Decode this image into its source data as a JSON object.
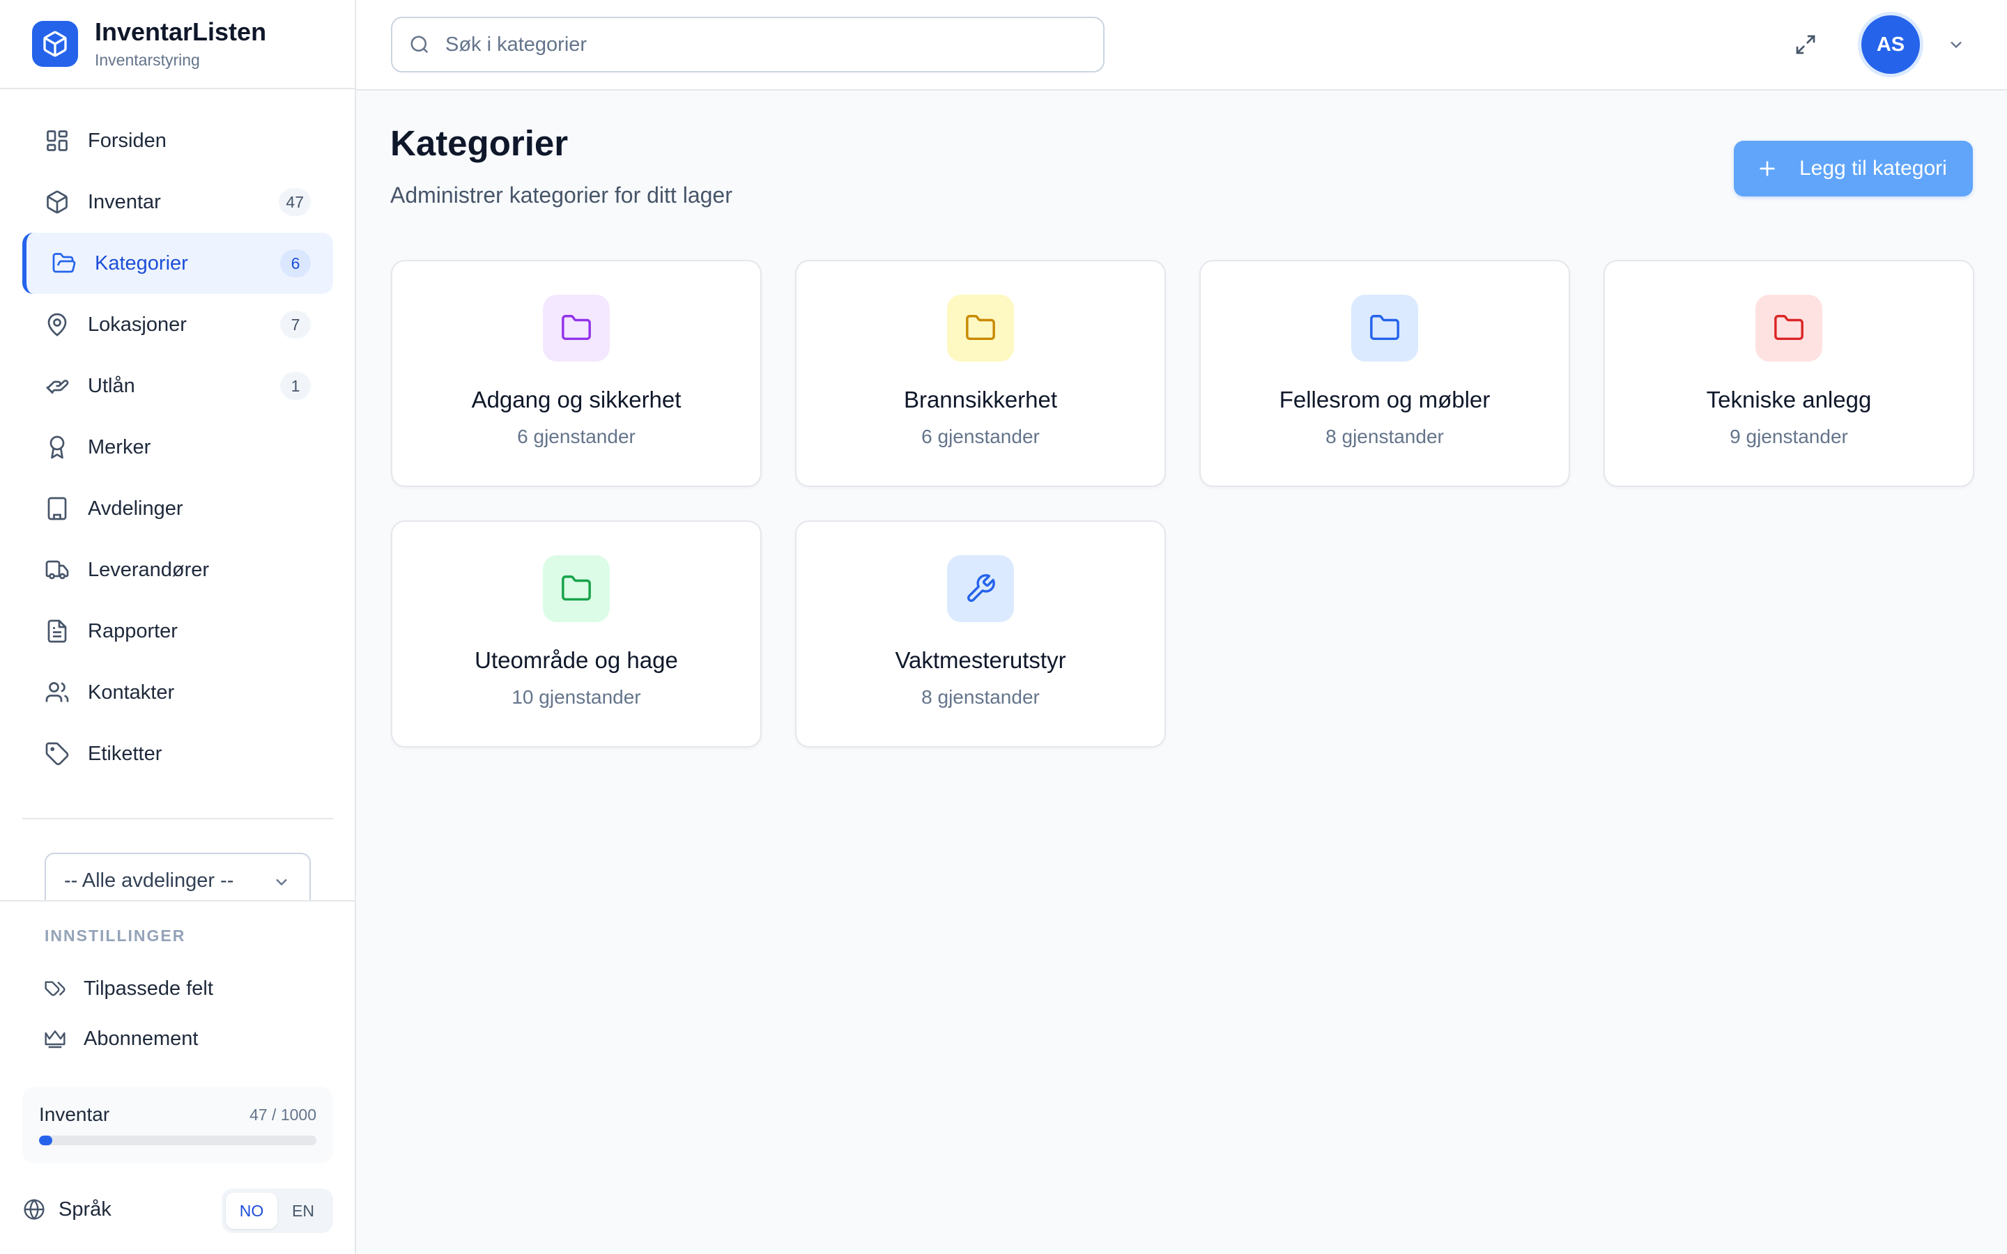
{
  "app": {
    "name": "InventarListen",
    "subtitle": "Inventarstyring"
  },
  "nav": [
    {
      "label": "Forsiden",
      "icon": "dashboard-icon",
      "badge": null
    },
    {
      "label": "Inventar",
      "icon": "box-icon",
      "badge": "47"
    },
    {
      "label": "Kategorier",
      "icon": "folder-open-icon",
      "badge": "6",
      "active": true
    },
    {
      "label": "Lokasjoner",
      "icon": "map-pin-icon",
      "badge": "7"
    },
    {
      "label": "Utlån",
      "icon": "hand-icon",
      "badge": "1"
    },
    {
      "label": "Merker",
      "icon": "award-icon",
      "badge": null
    },
    {
      "label": "Avdelinger",
      "icon": "building-icon",
      "badge": null
    },
    {
      "label": "Leverandører",
      "icon": "truck-icon",
      "badge": null
    },
    {
      "label": "Rapporter",
      "icon": "file-text-icon",
      "badge": null
    },
    {
      "label": "Kontakter",
      "icon": "users-icon",
      "badge": null
    },
    {
      "label": "Etiketter",
      "icon": "tag-icon",
      "badge": null
    }
  ],
  "department_select": {
    "value": "-- Alle avdelinger --"
  },
  "settings": {
    "title": "INNSTILLINGER",
    "items": [
      {
        "label": "Tilpassede felt",
        "icon": "tags-icon"
      },
      {
        "label": "Abonnement",
        "icon": "crown-icon"
      }
    ]
  },
  "usage": {
    "label": "Inventar",
    "count": "47 / 1000",
    "fraction": 0.047
  },
  "language": {
    "label": "Språk",
    "options": [
      "NO",
      "EN"
    ],
    "selected": "NO"
  },
  "search": {
    "placeholder": "Søk i kategorier"
  },
  "user": {
    "initials": "AS"
  },
  "page": {
    "title": "Kategorier",
    "subtitle": "Administrer kategorier for ditt lager",
    "add_label": "Legg til kategori"
  },
  "categories": [
    {
      "name": "Adgang og sikkerhet",
      "count": "6 gjenstander",
      "icon": "folder-icon",
      "color": "#9333ea",
      "bg": "#f3e8ff"
    },
    {
      "name": "Brannsikkerhet",
      "count": "6 gjenstander",
      "icon": "folder-icon",
      "color": "#ca8a04",
      "bg": "#fef9c3"
    },
    {
      "name": "Fellesrom og møbler",
      "count": "8 gjenstander",
      "icon": "folder-icon",
      "color": "#2563eb",
      "bg": "#dbeafe"
    },
    {
      "name": "Tekniske anlegg",
      "count": "9 gjenstander",
      "icon": "folder-icon",
      "color": "#dc2626",
      "bg": "#fee2e2"
    },
    {
      "name": "Uteområde og hage",
      "count": "10 gjenstander",
      "icon": "folder-icon",
      "color": "#16a34a",
      "bg": "#dcfce7"
    },
    {
      "name": "Vaktmesterutstyr",
      "count": "8 gjenstander",
      "icon": "wrench-icon",
      "color": "#2563eb",
      "bg": "#dbeafe"
    }
  ]
}
